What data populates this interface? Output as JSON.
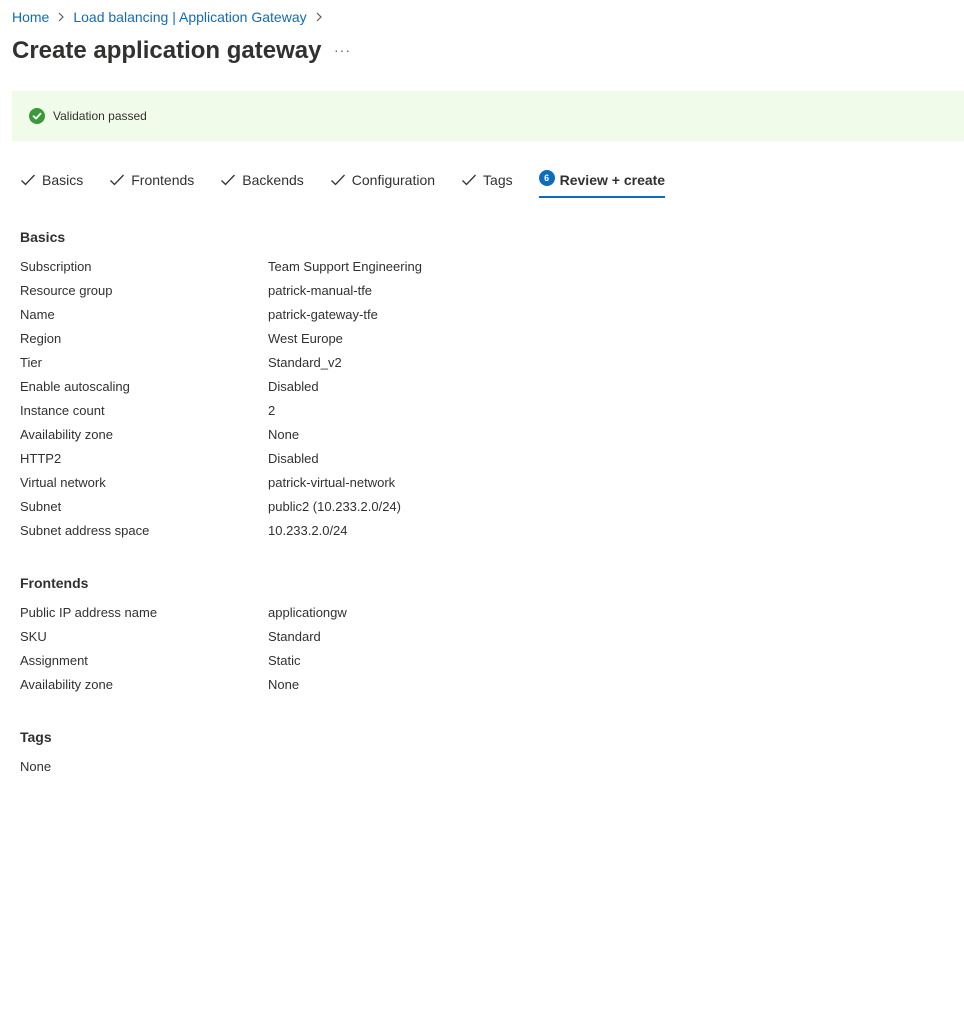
{
  "breadcrumb": {
    "home": "Home",
    "parent": "Load balancing | Application Gateway"
  },
  "page": {
    "title": "Create application gateway",
    "more": "···"
  },
  "validation": {
    "message": "Validation passed",
    "color": "#3a9a3a"
  },
  "tabs": [
    {
      "label": "Basics",
      "state": "done"
    },
    {
      "label": "Frontends",
      "state": "done"
    },
    {
      "label": "Backends",
      "state": "done"
    },
    {
      "label": "Configuration",
      "state": "done"
    },
    {
      "label": "Tags",
      "state": "done"
    },
    {
      "label": "Review + create",
      "state": "active",
      "number": "6"
    }
  ],
  "sections": {
    "basics": {
      "title": "Basics",
      "rows": [
        {
          "key": "Subscription",
          "value": "Team Support Engineering"
        },
        {
          "key": "Resource group",
          "value": "patrick-manual-tfe"
        },
        {
          "key": "Name",
          "value": "patrick-gateway-tfe"
        },
        {
          "key": "Region",
          "value": "West Europe"
        },
        {
          "key": "Tier",
          "value": "Standard_v2"
        },
        {
          "key": "Enable autoscaling",
          "value": "Disabled"
        },
        {
          "key": "Instance count",
          "value": "2"
        },
        {
          "key": "Availability zone",
          "value": "None"
        },
        {
          "key": "HTTP2",
          "value": "Disabled"
        },
        {
          "key": "Virtual network",
          "value": "patrick-virtual-network"
        },
        {
          "key": "Subnet",
          "value": "public2 (10.233.2.0/24)"
        },
        {
          "key": "Subnet address space",
          "value": "10.233.2.0/24"
        }
      ]
    },
    "frontends": {
      "title": "Frontends",
      "rows": [
        {
          "key": "Public IP address name",
          "value": "applicationgw"
        },
        {
          "key": "SKU",
          "value": "Standard"
        },
        {
          "key": "Assignment",
          "value": "Static"
        },
        {
          "key": "Availability zone",
          "value": "None"
        }
      ]
    },
    "tags": {
      "title": "Tags",
      "value": "None"
    }
  },
  "colors": {
    "accent": "#0f6cbd",
    "success_bg": "#f1fbea"
  }
}
